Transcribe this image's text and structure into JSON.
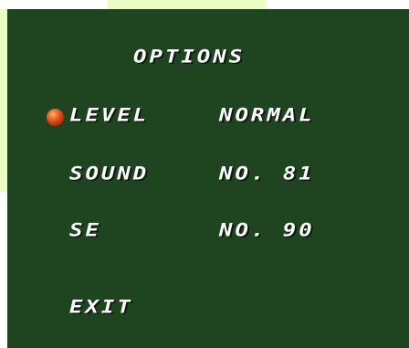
{
  "menu": {
    "title": "OPTIONS",
    "items": [
      {
        "label": "LEVEL",
        "value": "NORMAL",
        "selected": true
      },
      {
        "label": "SOUND",
        "value": "NO. 81",
        "selected": false
      },
      {
        "label": "SE",
        "value": "NO. 90",
        "selected": false
      }
    ],
    "exit_label": "EXIT",
    "cursor_icon": "red-ball-icon"
  },
  "colors": {
    "panel_background": "#1f4520",
    "text": "#ffffff",
    "cursor": "#e4541b",
    "backdrop_tint": "#ecfdc4"
  }
}
